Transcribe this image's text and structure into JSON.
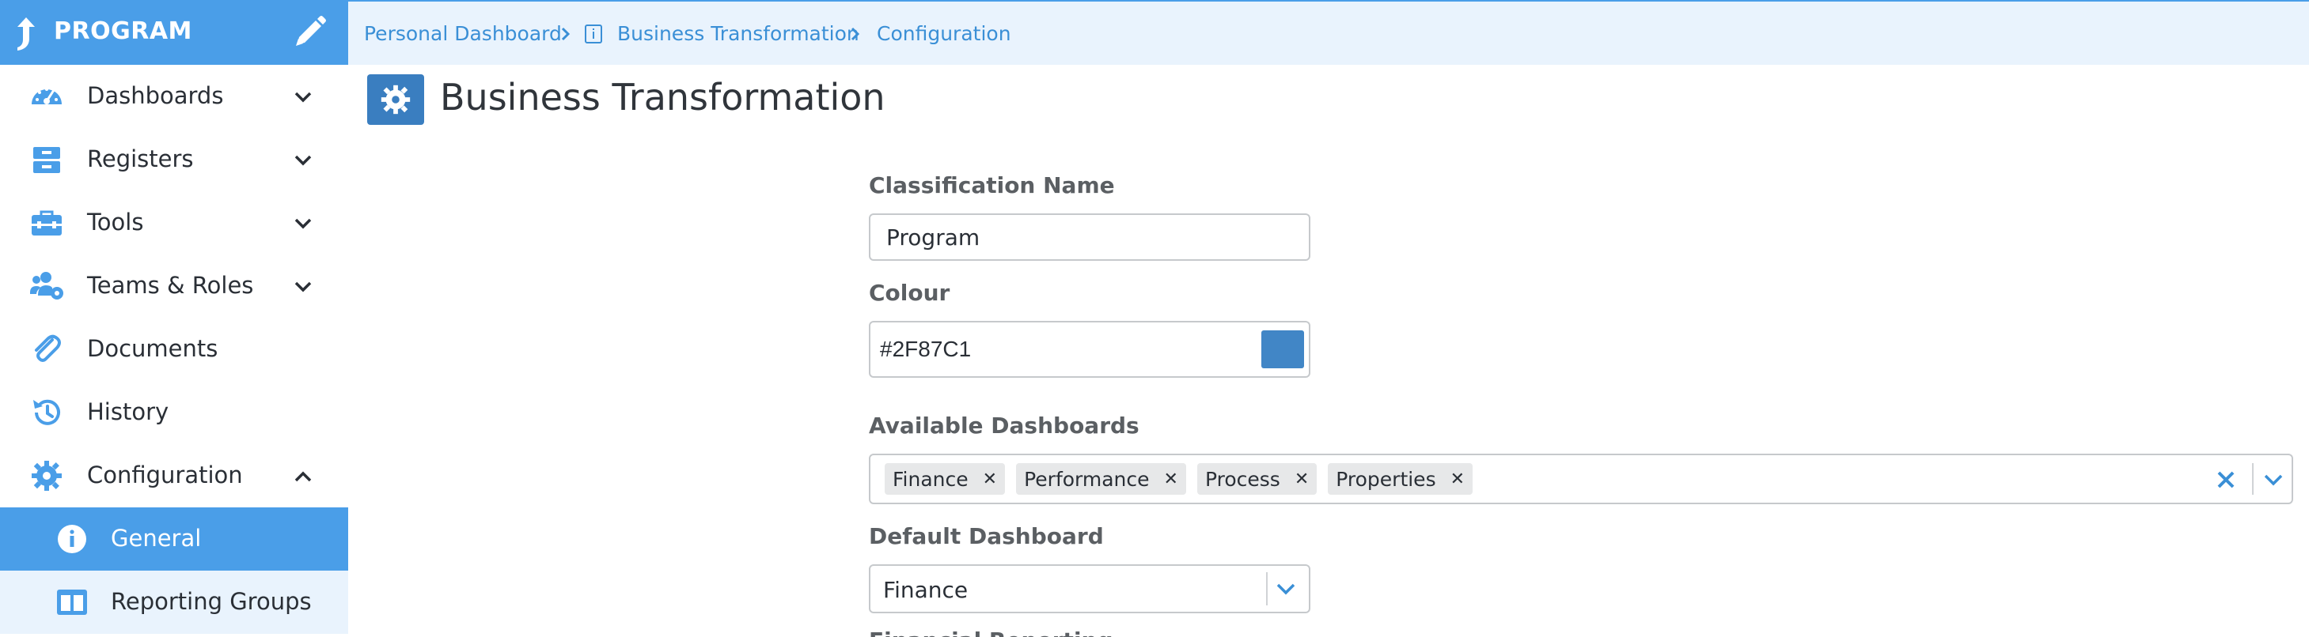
{
  "sidebar": {
    "brand_label": "PROGRAM",
    "items": [
      {
        "label": "Dashboards"
      },
      {
        "label": "Registers"
      },
      {
        "label": "Tools"
      },
      {
        "label": "Teams & Roles"
      },
      {
        "label": "Documents"
      },
      {
        "label": "History"
      },
      {
        "label": "Configuration"
      }
    ],
    "sub_items": [
      {
        "label": "General"
      },
      {
        "label": "Reporting Groups"
      }
    ]
  },
  "breadcrumb": {
    "items": [
      "Personal Dashboard",
      "Business Transformation",
      "Configuration"
    ]
  },
  "page": {
    "title": "Business Transformation"
  },
  "form": {
    "classification_label": "Classification Name",
    "classification_value": "Program",
    "colour_label": "Colour",
    "colour_value": "#2F87C1",
    "available_dashboards_label": "Available Dashboards",
    "available_dashboards": [
      "Finance",
      "Performance",
      "Process",
      "Properties"
    ],
    "default_dashboard_label": "Default Dashboard",
    "default_dashboard_value": "Finance",
    "next_label_partial": "Financial Reporting"
  },
  "colors": {
    "accent": "#4a9ee8",
    "link": "#3a8fd6",
    "swatch": "#4186c6"
  }
}
